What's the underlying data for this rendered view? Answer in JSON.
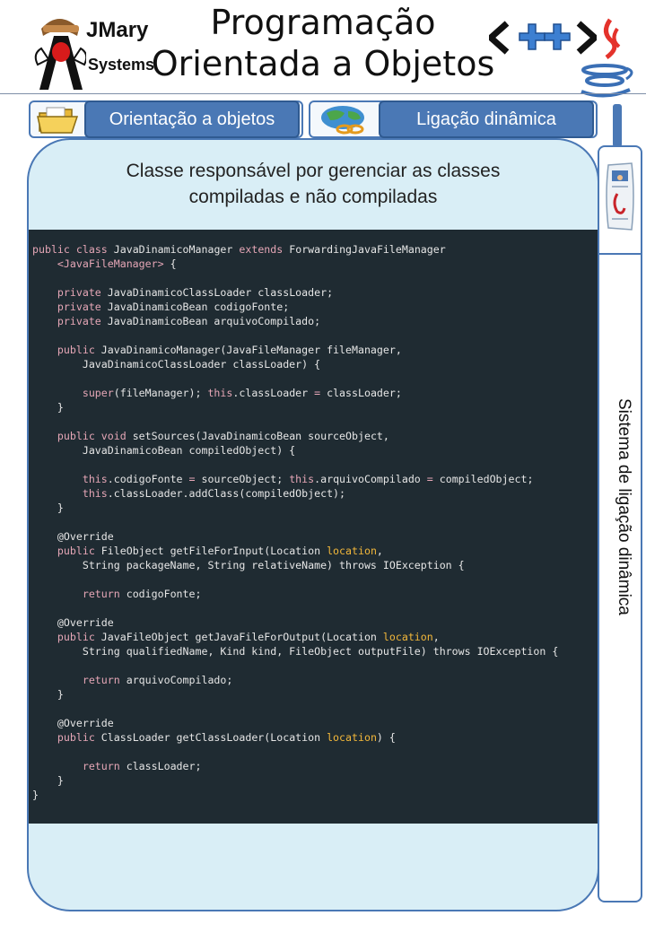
{
  "header": {
    "logo_brand": "JMary",
    "logo_sub": "Systems",
    "title_line1": "Programação",
    "title_line2": "Orientada a Objetos",
    "cpp_badge": "<++>"
  },
  "tabs": [
    {
      "label": "Orientação a objetos",
      "icon": "folder-icon"
    },
    {
      "label": "Ligação dinâmica",
      "icon": "globe-link-icon"
    }
  ],
  "side_panel": {
    "label": "Sistema de ligação dinâmica",
    "icon": "newspaper-icon"
  },
  "main": {
    "subtitle_line1": "Classe responsável por gerenciar as classes",
    "subtitle_line2": "compiladas e não compiladas"
  },
  "code_lines": [
    "public class JavaDinamicoManager extends ForwardingJavaFileManager",
    "    <JavaFileManager> {",
    "",
    "    private JavaDinamicoClassLoader classLoader;",
    "    private JavaDinamicoBean codigoFonte;",
    "    private JavaDinamicoBean arquivoCompilado;",
    "",
    "    public JavaDinamicoManager(JavaFileManager fileManager,",
    "        JavaDinamicoClassLoader classLoader) {",
    "",
    "        super(fileManager); this.classLoader = classLoader;",
    "    }",
    "",
    "    public void setSources(JavaDinamicoBean sourceObject,",
    "        JavaDinamicoBean compiledObject) {",
    "",
    "        this.codigoFonte = sourceObject; this.arquivoCompilado = compiledObject;",
    "        this.classLoader.addClass(compiledObject);",
    "    }",
    "",
    "    @Override",
    "    public FileObject getFileForInput(Location location,",
    "        String packageName, String relativeName) throws IOException {",
    "",
    "        return codigoFonte;",
    "",
    "    @Override",
    "    public JavaFileObject getJavaFileForOutput(Location location,",
    "        String qualifiedName, Kind kind, FileObject outputFile) throws IOException {",
    "",
    "        return arquivoCompilado;",
    "    }",
    "",
    "    @Override",
    "    public ClassLoader getClassLoader(Location location) {",
    "",
    "        return classLoader;",
    "    }",
    "}"
  ],
  "colors": {
    "accent": "#4a78b5",
    "panel_bg": "#d9eef6",
    "code_bg": "#1f2b32",
    "keyword": "#e5a6b6",
    "param": "#f2b73a"
  }
}
